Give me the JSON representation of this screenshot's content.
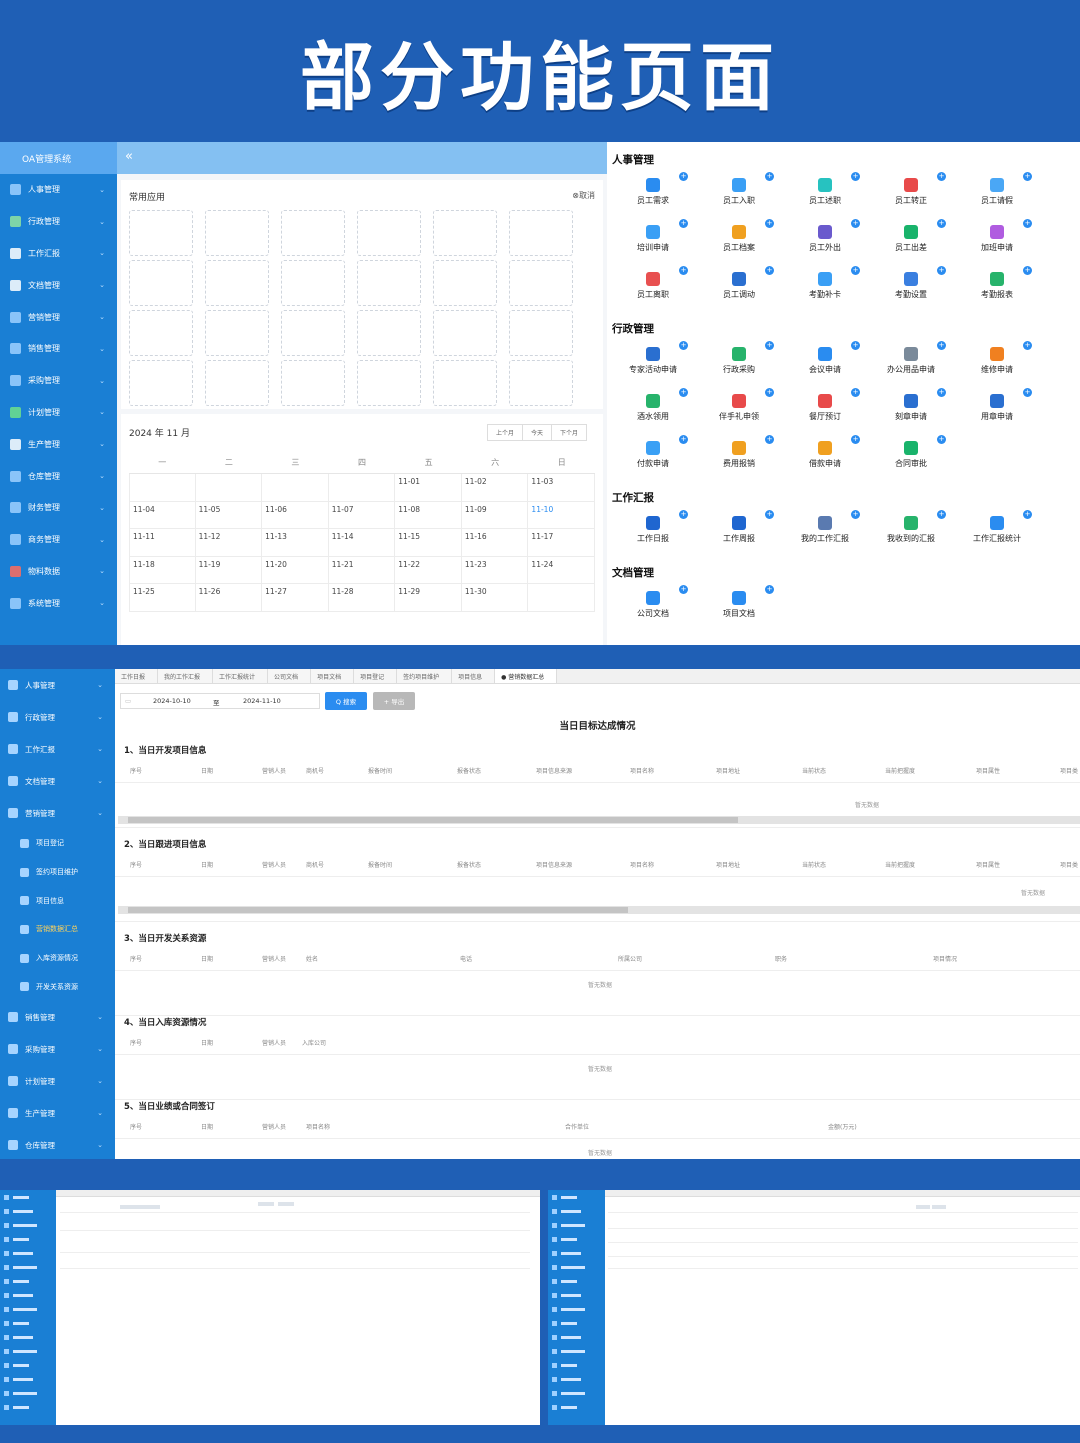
{
  "banner": {
    "title": "部分功能页面"
  },
  "panel1": {
    "logo": "OA管理系统",
    "collapse_icon": "«",
    "sidebar": [
      {
        "label": "人事管理",
        "icon_color": "#9fd0ff"
      },
      {
        "label": "行政管理",
        "icon_color": "#8fe3a0"
      },
      {
        "label": "工作汇报",
        "icon_color": "#ffffff"
      },
      {
        "label": "文档管理",
        "icon_color": "#ffffff"
      },
      {
        "label": "营销管理",
        "icon_color": "#9fd0ff"
      },
      {
        "label": "销售管理",
        "icon_color": "#9fd0ff"
      },
      {
        "label": "采购管理",
        "icon_color": "#9fd0ff"
      },
      {
        "label": "计划管理",
        "icon_color": "#6fe08a"
      },
      {
        "label": "生产管理",
        "icon_color": "#ffffff"
      },
      {
        "label": "仓库管理",
        "icon_color": "#9fd0ff"
      },
      {
        "label": "财务管理",
        "icon_color": "#9fd0ff"
      },
      {
        "label": "商务管理",
        "icon_color": "#9fd0ff"
      },
      {
        "label": "物料数据",
        "icon_color": "#ff6b5c"
      },
      {
        "label": "系统管理",
        "icon_color": "#9fd0ff"
      }
    ],
    "common_apps": {
      "title": "常用应用",
      "cancel": "⊗取消"
    },
    "calendar": {
      "month": "2024 年 11 月",
      "buttons": [
        "上个月",
        "今天",
        "下个月"
      ],
      "weekdays": [
        "一",
        "二",
        "三",
        "四",
        "五",
        "六",
        "日"
      ],
      "days": [
        "",
        "",
        "",
        "",
        "11-01",
        "11-02",
        "11-03",
        "11-04",
        "11-05",
        "11-06",
        "11-07",
        "11-08",
        "11-09",
        "11-10",
        "11-11",
        "11-12",
        "11-13",
        "11-14",
        "11-15",
        "11-16",
        "11-17",
        "11-18",
        "11-19",
        "11-20",
        "11-21",
        "11-22",
        "11-23",
        "11-24",
        "11-25",
        "11-26",
        "11-27",
        "11-28",
        "11-29",
        "11-30",
        ""
      ],
      "today": "11-10"
    },
    "sections": [
      {
        "title": "人事管理",
        "apps": [
          {
            "label": "员工需求",
            "color": "#2a8cf0"
          },
          {
            "label": "员工入职",
            "color": "#3a9ff5"
          },
          {
            "label": "员工述职",
            "color": "#27c2c0"
          },
          {
            "label": "员工转正",
            "color": "#e84a4a"
          },
          {
            "label": "员工请假",
            "color": "#4aa7f5"
          },
          {
            "label": "培训申请",
            "color": "#3a9ff5"
          },
          {
            "label": "员工档案",
            "color": "#f0a020"
          },
          {
            "label": "员工外出",
            "color": "#6a5acd"
          },
          {
            "label": "员工出差",
            "color": "#19b36b"
          },
          {
            "label": "加班申请",
            "color": "#b05ce0"
          },
          {
            "label": "员工离职",
            "color": "#e85050"
          },
          {
            "label": "员工调动",
            "color": "#2a6fd0"
          },
          {
            "label": "考勤补卡",
            "color": "#3a9ff5"
          },
          {
            "label": "考勤设置",
            "color": "#3a7fe0"
          },
          {
            "label": "考勤报表",
            "color": "#27b36b"
          }
        ]
      },
      {
        "title": "行政管理",
        "apps": [
          {
            "label": "专家活动申请",
            "color": "#2a6fd0"
          },
          {
            "label": "行政采购",
            "color": "#27b36b"
          },
          {
            "label": "会议申请",
            "color": "#2a8cf0"
          },
          {
            "label": "办公用品申请",
            "color": "#7a8a9a"
          },
          {
            "label": "维修申请",
            "color": "#f08020"
          },
          {
            "label": "酒水领用",
            "color": "#27b36b"
          },
          {
            "label": "伴手礼申领",
            "color": "#e84a4a"
          },
          {
            "label": "餐厅预订",
            "color": "#e84a4a"
          },
          {
            "label": "刻章申请",
            "color": "#2a6fd0"
          },
          {
            "label": "用章申请",
            "color": "#2a6fd0"
          },
          {
            "label": "付款申请",
            "color": "#3aa0f5"
          },
          {
            "label": "费用报销",
            "color": "#f0a020"
          },
          {
            "label": "借款申请",
            "color": "#f0a020"
          },
          {
            "label": "合同审批",
            "color": "#19b36b"
          }
        ]
      },
      {
        "title": "工作汇报",
        "apps": [
          {
            "label": "工作日报",
            "color": "#1f66d0"
          },
          {
            "label": "工作周报",
            "color": "#1f66d0"
          },
          {
            "label": "我的工作汇报",
            "color": "#5a7ab0"
          },
          {
            "label": "我收到的汇报",
            "color": "#27b36b"
          },
          {
            "label": "工作汇报统计",
            "color": "#2a8cf0"
          }
        ]
      },
      {
        "title": "文档管理",
        "apps": [
          {
            "label": "公司文档",
            "color": "#2a8cf0"
          },
          {
            "label": "项目文档",
            "color": "#2a8cf0"
          }
        ]
      }
    ]
  },
  "panel2": {
    "sidebar": [
      {
        "label": "人事管理",
        "type": "item"
      },
      {
        "label": "行政管理",
        "type": "item"
      },
      {
        "label": "工作汇报",
        "type": "item"
      },
      {
        "label": "文档管理",
        "type": "item"
      },
      {
        "label": "营销管理",
        "type": "item"
      },
      {
        "label": "项目登记",
        "type": "sub"
      },
      {
        "label": "签约项目维护",
        "type": "sub"
      },
      {
        "label": "项目信息",
        "type": "sub"
      },
      {
        "label": "营销数据汇总",
        "type": "sub-active"
      },
      {
        "label": "入库资源情况",
        "type": "sub"
      },
      {
        "label": "开发关系资源",
        "type": "sub"
      },
      {
        "label": "销售管理",
        "type": "item"
      },
      {
        "label": "采购管理",
        "type": "item"
      },
      {
        "label": "计划管理",
        "type": "item"
      },
      {
        "label": "生产管理",
        "type": "item"
      },
      {
        "label": "仓库管理",
        "type": "item"
      }
    ],
    "tabs": [
      "工作日报",
      "我的工作汇报",
      "工作汇报统计",
      "公司文档",
      "项目文档",
      "项目登记",
      "签约项目维护",
      "项目信息",
      "● 营销数据汇总"
    ],
    "date_from": "2024-10-10",
    "date_sep": "至",
    "date_to": "2024-11-10",
    "search_btn": "Q 搜索",
    "export_btn": "+ 导出",
    "heading": "当日目标达成情况",
    "empty_text": "暂无数据",
    "sections": [
      {
        "title": "1、当日开发项目信息",
        "cols": [
          "序号",
          "日期",
          "营销人员",
          "商机号",
          "报备时间",
          "报备状态",
          "项目信息来源",
          "项目名称",
          "项目地址",
          "当前状态",
          "当前把握度",
          "项目属性",
          "项目类"
        ]
      },
      {
        "title": "2、当日跟进项目信息",
        "cols": [
          "序号",
          "日期",
          "营销人员",
          "商机号",
          "报备时间",
          "报备状态",
          "项目信息来源",
          "项目名称",
          "项目地址",
          "当前状态",
          "当前把握度",
          "项目属性",
          "项目类"
        ]
      },
      {
        "title": "3、当日开发关系资源",
        "cols": [
          "序号",
          "日期",
          "营销人员",
          "姓名",
          "电话",
          "所属公司",
          "职务",
          "项目情况"
        ]
      },
      {
        "title": "4、当日入库资源情况",
        "cols": [
          "序号",
          "日期",
          "营销人员",
          "入库公司"
        ]
      },
      {
        "title": "5、当日业绩或合同签订",
        "cols": [
          "序号",
          "日期",
          "营销人员",
          "项目名称",
          "合作单位",
          "金额(万元)"
        ]
      }
    ]
  },
  "colors": {
    "brand_blue": "#1f5fb5",
    "sidebar_blue": "#1a7fd4",
    "primary": "#2a8cf0"
  }
}
